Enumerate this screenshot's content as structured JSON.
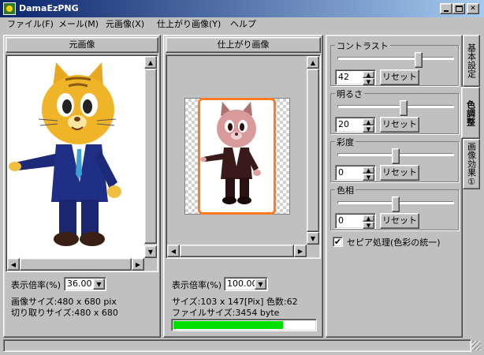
{
  "window": {
    "title": "DamaEzPNG"
  },
  "menu": [
    {
      "label": "ファイル(F)"
    },
    {
      "label": "メール(M)"
    },
    {
      "label": "元画像(X)"
    },
    {
      "label": "仕上がり画像(Y)"
    },
    {
      "label": "ヘルプ"
    }
  ],
  "source_pane": {
    "title": "元画像",
    "zoom_label": "表示倍率(%)",
    "zoom_value": "36.00",
    "image_size": "画像サイズ:480 x 680 pix",
    "crop_size": "切り取りサイズ:480 x 680"
  },
  "result_pane": {
    "title": "仕上がり画像",
    "zoom_label": "表示倍率(%)",
    "zoom_value": "100.00",
    "size_info": "サイズ:103 x 147[Pix] 色数:62",
    "file_size": "ファイルサイズ:3454 byte",
    "progress": 0.77
  },
  "adjust": {
    "reset_label": "リセット",
    "contrast": {
      "label": "コントラスト",
      "value": "42",
      "level": 0.71
    },
    "brightness": {
      "label": "明るさ",
      "value": "20",
      "level": 0.57
    },
    "saturation": {
      "label": "彩度",
      "value": "0",
      "level": 0.5
    },
    "hue": {
      "label": "色相",
      "value": "0",
      "level": 0.5
    },
    "sepia": {
      "label": "セピア処理(色彩の統一)",
      "checked": true
    }
  },
  "tabs": [
    {
      "label": "基本設定"
    },
    {
      "label": "色調整"
    },
    {
      "label": "画像効果①"
    }
  ],
  "colors": {
    "title_start": "#0a246a",
    "title_end": "#a6caf0",
    "progress": "#00e000"
  }
}
